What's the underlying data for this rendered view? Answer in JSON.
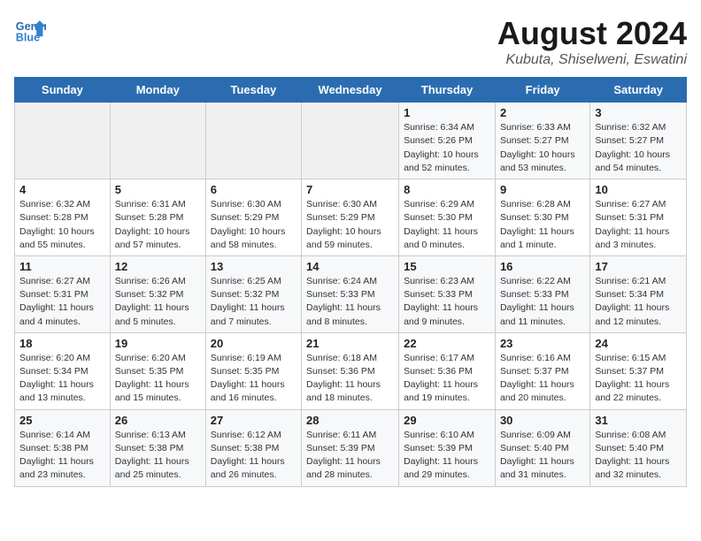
{
  "header": {
    "logo_line1": "General",
    "logo_line2": "Blue",
    "title": "August 2024",
    "subtitle": "Kubuta, Shiselweni, Eswatini"
  },
  "weekdays": [
    "Sunday",
    "Monday",
    "Tuesday",
    "Wednesday",
    "Thursday",
    "Friday",
    "Saturday"
  ],
  "weeks": [
    [
      {
        "day": "",
        "info": ""
      },
      {
        "day": "",
        "info": ""
      },
      {
        "day": "",
        "info": ""
      },
      {
        "day": "",
        "info": ""
      },
      {
        "day": "1",
        "info": "Sunrise: 6:34 AM\nSunset: 5:26 PM\nDaylight: 10 hours\nand 52 minutes."
      },
      {
        "day": "2",
        "info": "Sunrise: 6:33 AM\nSunset: 5:27 PM\nDaylight: 10 hours\nand 53 minutes."
      },
      {
        "day": "3",
        "info": "Sunrise: 6:32 AM\nSunset: 5:27 PM\nDaylight: 10 hours\nand 54 minutes."
      }
    ],
    [
      {
        "day": "4",
        "info": "Sunrise: 6:32 AM\nSunset: 5:28 PM\nDaylight: 10 hours\nand 55 minutes."
      },
      {
        "day": "5",
        "info": "Sunrise: 6:31 AM\nSunset: 5:28 PM\nDaylight: 10 hours\nand 57 minutes."
      },
      {
        "day": "6",
        "info": "Sunrise: 6:30 AM\nSunset: 5:29 PM\nDaylight: 10 hours\nand 58 minutes."
      },
      {
        "day": "7",
        "info": "Sunrise: 6:30 AM\nSunset: 5:29 PM\nDaylight: 10 hours\nand 59 minutes."
      },
      {
        "day": "8",
        "info": "Sunrise: 6:29 AM\nSunset: 5:30 PM\nDaylight: 11 hours\nand 0 minutes."
      },
      {
        "day": "9",
        "info": "Sunrise: 6:28 AM\nSunset: 5:30 PM\nDaylight: 11 hours\nand 1 minute."
      },
      {
        "day": "10",
        "info": "Sunrise: 6:27 AM\nSunset: 5:31 PM\nDaylight: 11 hours\nand 3 minutes."
      }
    ],
    [
      {
        "day": "11",
        "info": "Sunrise: 6:27 AM\nSunset: 5:31 PM\nDaylight: 11 hours\nand 4 minutes."
      },
      {
        "day": "12",
        "info": "Sunrise: 6:26 AM\nSunset: 5:32 PM\nDaylight: 11 hours\nand 5 minutes."
      },
      {
        "day": "13",
        "info": "Sunrise: 6:25 AM\nSunset: 5:32 PM\nDaylight: 11 hours\nand 7 minutes."
      },
      {
        "day": "14",
        "info": "Sunrise: 6:24 AM\nSunset: 5:33 PM\nDaylight: 11 hours\nand 8 minutes."
      },
      {
        "day": "15",
        "info": "Sunrise: 6:23 AM\nSunset: 5:33 PM\nDaylight: 11 hours\nand 9 minutes."
      },
      {
        "day": "16",
        "info": "Sunrise: 6:22 AM\nSunset: 5:33 PM\nDaylight: 11 hours\nand 11 minutes."
      },
      {
        "day": "17",
        "info": "Sunrise: 6:21 AM\nSunset: 5:34 PM\nDaylight: 11 hours\nand 12 minutes."
      }
    ],
    [
      {
        "day": "18",
        "info": "Sunrise: 6:20 AM\nSunset: 5:34 PM\nDaylight: 11 hours\nand 13 minutes."
      },
      {
        "day": "19",
        "info": "Sunrise: 6:20 AM\nSunset: 5:35 PM\nDaylight: 11 hours\nand 15 minutes."
      },
      {
        "day": "20",
        "info": "Sunrise: 6:19 AM\nSunset: 5:35 PM\nDaylight: 11 hours\nand 16 minutes."
      },
      {
        "day": "21",
        "info": "Sunrise: 6:18 AM\nSunset: 5:36 PM\nDaylight: 11 hours\nand 18 minutes."
      },
      {
        "day": "22",
        "info": "Sunrise: 6:17 AM\nSunset: 5:36 PM\nDaylight: 11 hours\nand 19 minutes."
      },
      {
        "day": "23",
        "info": "Sunrise: 6:16 AM\nSunset: 5:37 PM\nDaylight: 11 hours\nand 20 minutes."
      },
      {
        "day": "24",
        "info": "Sunrise: 6:15 AM\nSunset: 5:37 PM\nDaylight: 11 hours\nand 22 minutes."
      }
    ],
    [
      {
        "day": "25",
        "info": "Sunrise: 6:14 AM\nSunset: 5:38 PM\nDaylight: 11 hours\nand 23 minutes."
      },
      {
        "day": "26",
        "info": "Sunrise: 6:13 AM\nSunset: 5:38 PM\nDaylight: 11 hours\nand 25 minutes."
      },
      {
        "day": "27",
        "info": "Sunrise: 6:12 AM\nSunset: 5:38 PM\nDaylight: 11 hours\nand 26 minutes."
      },
      {
        "day": "28",
        "info": "Sunrise: 6:11 AM\nSunset: 5:39 PM\nDaylight: 11 hours\nand 28 minutes."
      },
      {
        "day": "29",
        "info": "Sunrise: 6:10 AM\nSunset: 5:39 PM\nDaylight: 11 hours\nand 29 minutes."
      },
      {
        "day": "30",
        "info": "Sunrise: 6:09 AM\nSunset: 5:40 PM\nDaylight: 11 hours\nand 31 minutes."
      },
      {
        "day": "31",
        "info": "Sunrise: 6:08 AM\nSunset: 5:40 PM\nDaylight: 11 hours\nand 32 minutes."
      }
    ]
  ]
}
